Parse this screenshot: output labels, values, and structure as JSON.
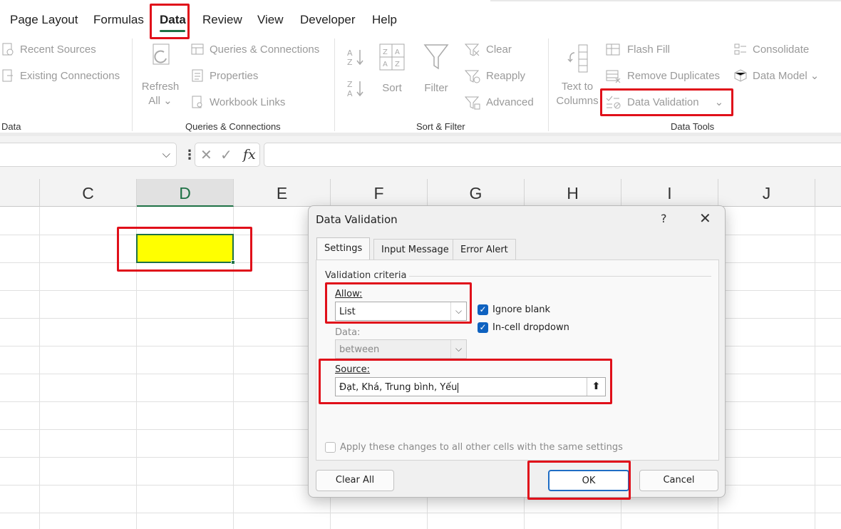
{
  "tabs": [
    "Page Layout",
    "Formulas",
    "Data",
    "Review",
    "View",
    "Developer",
    "Help"
  ],
  "active_tab": "Data",
  "ribbon": {
    "get_data": {
      "recent_sources": "Recent Sources",
      "existing_connections": "Existing Connections",
      "group_label": "Data"
    },
    "queries": {
      "refresh_all_line1": "Refresh",
      "refresh_all_line2": "All",
      "queries_connections": "Queries & Connections",
      "properties": "Properties",
      "workbook_links": "Workbook Links",
      "group_label": "Queries & Connections"
    },
    "sort_filter": {
      "sort": "Sort",
      "filter": "Filter",
      "clear": "Clear",
      "reapply": "Reapply",
      "advanced": "Advanced",
      "group_label": "Sort & Filter"
    },
    "data_tools": {
      "text_to_columns_line1": "Text to",
      "text_to_columns_line2": "Columns",
      "flash_fill": "Flash Fill",
      "remove_duplicates": "Remove Duplicates",
      "data_validation": "Data Validation",
      "consolidate": "Consolidate",
      "data_model": "Data Model",
      "group_label": "Data Tools"
    }
  },
  "formula_bar": {
    "fx": "fx",
    "cancel": "✕",
    "enter": "✓",
    "dots": "⋮"
  },
  "columns": [
    "C",
    "D",
    "E",
    "F",
    "G",
    "H",
    "I",
    "J"
  ],
  "selected_column": "D",
  "selected_cell_color": "#FFFF00",
  "dialog": {
    "title": "Data Validation",
    "help": "?",
    "close": "✕",
    "tabs": [
      "Settings",
      "Input Message",
      "Error Alert"
    ],
    "active_tab": "Settings",
    "section_title": "Validation criteria",
    "allow_label": "Allow:",
    "allow_value": "List",
    "ignore_blank": "Ignore blank",
    "ignore_blank_checked": true,
    "in_cell_dropdown": "In-cell dropdown",
    "in_cell_dropdown_checked": true,
    "data_label": "Data:",
    "data_value": "between",
    "source_label": "Source:",
    "source_value": "Đạt, Khá, Trung bình, Yếu",
    "apply_all": "Apply these changes to all other cells with the same settings",
    "clear_all": "Clear All",
    "ok": "OK",
    "cancel": "Cancel"
  },
  "colors": {
    "accent_green": "#1E7145",
    "highlight_red": "#E0101A",
    "checkbox_blue": "#0F62C0"
  }
}
